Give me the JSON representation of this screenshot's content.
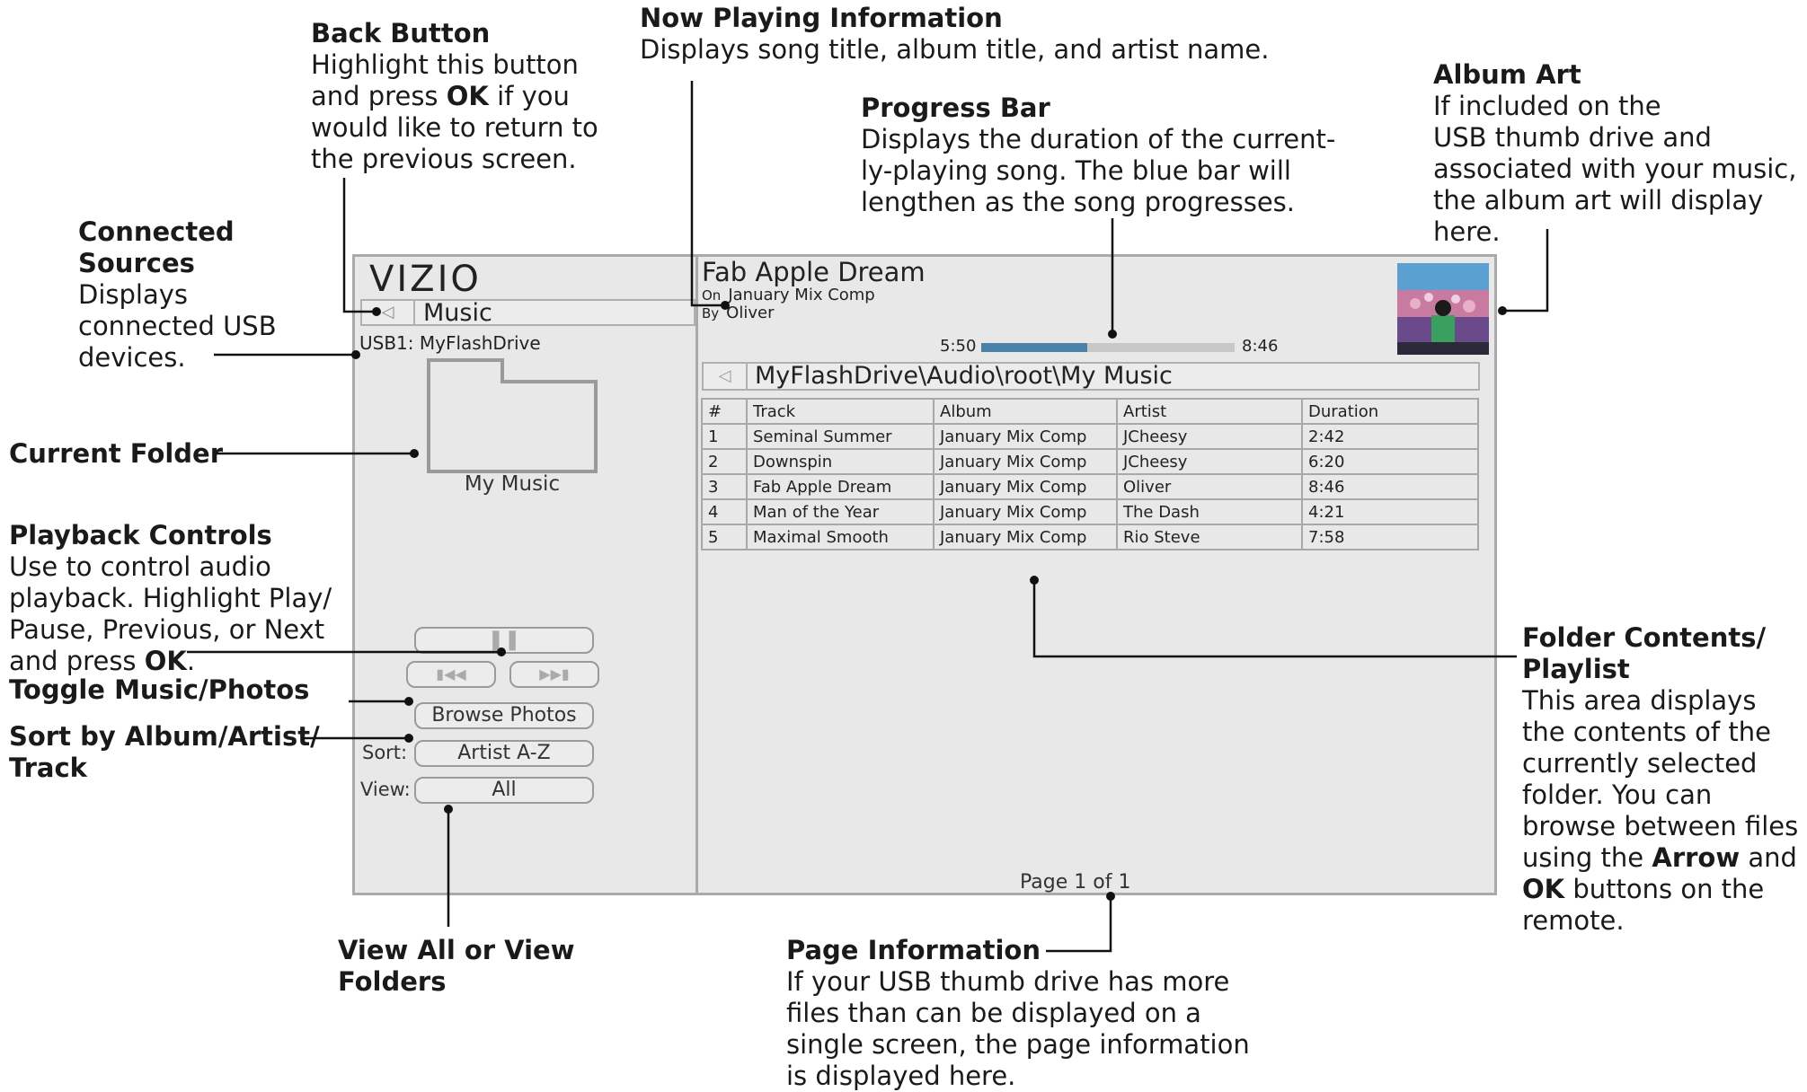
{
  "callouts": {
    "back_button": {
      "title": "Back Button",
      "lines": [
        "Highlight this button",
        "and press OK if you",
        "would like to return to",
        "the previous screen."
      ]
    },
    "now_playing": {
      "title": "Now Playing Information",
      "lines": [
        "Displays song title, album title, and artist name."
      ]
    },
    "progress_bar": {
      "title": "Progress Bar",
      "lines": [
        "Displays the duration of the current-",
        "ly-playing song. The blue bar will",
        "lengthen as the song progresses."
      ]
    },
    "album_art": {
      "title": "Album Art",
      "lines": [
        "If included on the",
        "USB thumb drive and",
        "associated with your music,",
        "the album art will display",
        "here."
      ]
    },
    "connected_sources": {
      "title": "Connected Sources",
      "lines": [
        "Displays",
        "connected USB",
        "devices."
      ]
    },
    "current_folder": {
      "title": "Current Folder"
    },
    "playback_controls": {
      "title": "Playback Controls",
      "lines": [
        "Use to control audio",
        "playback. Highlight Play/",
        "Pause, Previous, or Next",
        "and press OK."
      ]
    },
    "toggle": {
      "title": "Toggle Music/Photos"
    },
    "sort": {
      "title": "Sort by Album/Artist/",
      "title2": "Track"
    },
    "view": {
      "title": "View All or View",
      "title2": "Folders"
    },
    "page_info": {
      "title": "Page Information",
      "lines": [
        "If your USB thumb drive has more",
        "files than can be displayed on a",
        "single screen, the page information",
        "is displayed here."
      ]
    },
    "folder_contents": {
      "title": "Folder Contents/",
      "title2": "Playlist",
      "lines": [
        "This area displays",
        "the contents of the",
        "currently selected",
        "folder. You can",
        "browse between files",
        "using the Arrow and",
        "OK buttons on the",
        "remote."
      ]
    }
  },
  "screen": {
    "logo": "VIZIO",
    "section": "Music",
    "usb": "USB1: MyFlashDrive",
    "folder_name": "My Music",
    "browse_label": "Browse Photos",
    "sort_label": "Sort:",
    "sort_value": "Artist A-Z",
    "view_label": "View:",
    "view_value": "All",
    "song_title": "Fab Apple Dream",
    "on_label": "On",
    "album": "January Mix Comp",
    "by_label": "By",
    "artist": "Oliver",
    "elapsed": "5:50",
    "total": "8:46",
    "progress_fraction": 0.42,
    "path": "MyFlashDrive\\Audio\\root\\My Music",
    "columns": [
      "#",
      "Track",
      "Album",
      "Artist",
      "Duration"
    ],
    "rows": [
      [
        "1",
        "Seminal Summer",
        "January Mix Comp",
        "JCheesy",
        "2:42"
      ],
      [
        "2",
        "Downspin",
        "January Mix Comp",
        "JCheesy",
        "6:20"
      ],
      [
        "3",
        "Fab Apple Dream",
        "January Mix Comp",
        "Oliver",
        "8:46"
      ],
      [
        "4",
        "Man of the Year",
        "January Mix Comp",
        "The Dash",
        "4:21"
      ],
      [
        "5",
        "Maximal Smooth",
        "January Mix Comp",
        "Rio Steve",
        "7:58"
      ]
    ],
    "page": "Page 1 of 1"
  },
  "colors": {
    "progress": "#4a82a8",
    "panel": "#e8e8e8",
    "border": "#aaaaaa"
  }
}
